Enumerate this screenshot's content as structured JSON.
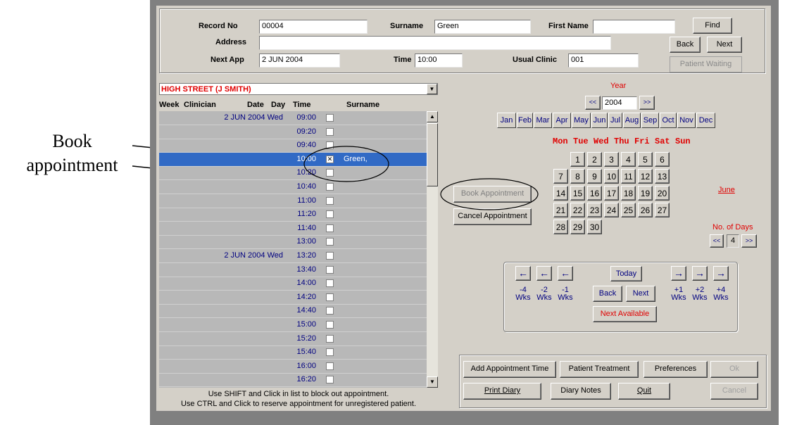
{
  "annotation": {
    "line1": "Book",
    "line2": "appointment"
  },
  "header": {
    "record_no_label": "Record No",
    "record_no": "00004",
    "surname_label": "Surname",
    "surname": "Green",
    "first_name_label": "First Name",
    "first_name": "",
    "address_label": "Address",
    "address": "",
    "next_app_label": "Next App",
    "next_app": "2 JUN 2004",
    "time_label": "Time",
    "time": "10:00",
    "usual_clinic_label": "Usual Clinic",
    "usual_clinic": "001",
    "find_label": "Find",
    "back_label": "Back",
    "next_label": "Next",
    "patient_waiting_label": "Patient Waiting"
  },
  "diary": {
    "clinic_selected": "HIGH STREET (J SMITH)",
    "columns": {
      "week": "Week",
      "clinician": "Clinician",
      "date": "Date",
      "day": "Day",
      "time": "Time",
      "surname": "Surname"
    },
    "rows": [
      {
        "date": "2 JUN 2004  Wed",
        "time": "09:00",
        "check": "",
        "surname": ""
      },
      {
        "date": "",
        "time": "09:20",
        "check": "",
        "surname": ""
      },
      {
        "date": "",
        "time": "09:40",
        "check": "",
        "surname": ""
      },
      {
        "date": "",
        "time": "10:00",
        "check": "✕",
        "surname": "Green,"
      },
      {
        "date": "",
        "time": "10:20",
        "check": "",
        "surname": ""
      },
      {
        "date": "",
        "time": "10:40",
        "check": "",
        "surname": ""
      },
      {
        "date": "",
        "time": "11:00",
        "check": "",
        "surname": ""
      },
      {
        "date": "",
        "time": "11:20",
        "check": "",
        "surname": ""
      },
      {
        "date": "",
        "time": "11:40",
        "check": "",
        "surname": ""
      },
      {
        "date": "",
        "time": "13:00",
        "check": "",
        "surname": ""
      },
      {
        "date": "2 JUN 2004  Wed",
        "time": "13:20",
        "check": "",
        "surname": ""
      },
      {
        "date": "",
        "time": "13:40",
        "check": "",
        "surname": ""
      },
      {
        "date": "",
        "time": "14:00",
        "check": "",
        "surname": ""
      },
      {
        "date": "",
        "time": "14:20",
        "check": "",
        "surname": ""
      },
      {
        "date": "",
        "time": "14:40",
        "check": "",
        "surname": ""
      },
      {
        "date": "",
        "time": "15:00",
        "check": "",
        "surname": ""
      },
      {
        "date": "",
        "time": "15:20",
        "check": "",
        "surname": ""
      },
      {
        "date": "",
        "time": "15:40",
        "check": "",
        "surname": ""
      },
      {
        "date": "",
        "time": "16:00",
        "check": "",
        "surname": ""
      },
      {
        "date": "",
        "time": "16:20",
        "check": "",
        "surname": ""
      }
    ],
    "hint1": "Use SHIFT and Click in list to block out appointment.",
    "hint2": "Use CTRL and Click to reserve appointment for unregistered patient."
  },
  "actions": {
    "book": "Book Appointment",
    "cancel": "Cancel Appointment"
  },
  "calendar": {
    "year_label": "Year",
    "year": "2004",
    "prev": "<<",
    "next": ">>",
    "months": [
      "Jan",
      "Feb",
      "Mar",
      "Apr",
      "May",
      "Jun",
      "Jul",
      "Aug",
      "Sep",
      "Oct",
      "Nov",
      "Dec"
    ],
    "dow": [
      "Mon",
      "Tue",
      "Wed",
      "Thu",
      "Fri",
      "Sat",
      "Sun"
    ],
    "days": [
      "1",
      "2",
      "3",
      "4",
      "5",
      "6",
      "7",
      "8",
      "9",
      "10",
      "11",
      "12",
      "13",
      "14",
      "15",
      "16",
      "17",
      "18",
      "19",
      "20",
      "21",
      "22",
      "23",
      "24",
      "25",
      "26",
      "27",
      "28",
      "29",
      "30"
    ],
    "month_name": "June",
    "no_of_days_label": "No. of Days",
    "no_of_days": "4",
    "ndays_prev": "<<",
    "ndays_next": ">>"
  },
  "navigation": {
    "arrow_left": "←",
    "arrow_right": "→",
    "week_labels": [
      "-4 Wks",
      "-2 Wks",
      "-1 Wks",
      "+1 Wks",
      "+2 Wks",
      "+4 Wks"
    ],
    "today": "Today",
    "back": "Back",
    "next": "Next",
    "next_available": "Next Available"
  },
  "footer": {
    "add_time": "Add Appointment Time",
    "treatment": "Patient Treatment",
    "preferences": "Preferences",
    "ok": "Ok",
    "print": "Print Diary",
    "notes": "Diary Notes",
    "quit": "Quit",
    "cancel": "Cancel"
  },
  "colors": {
    "red": "#e00000",
    "navy": "#000080",
    "selection": "#316ac5",
    "panel": "#d4d0c8"
  }
}
